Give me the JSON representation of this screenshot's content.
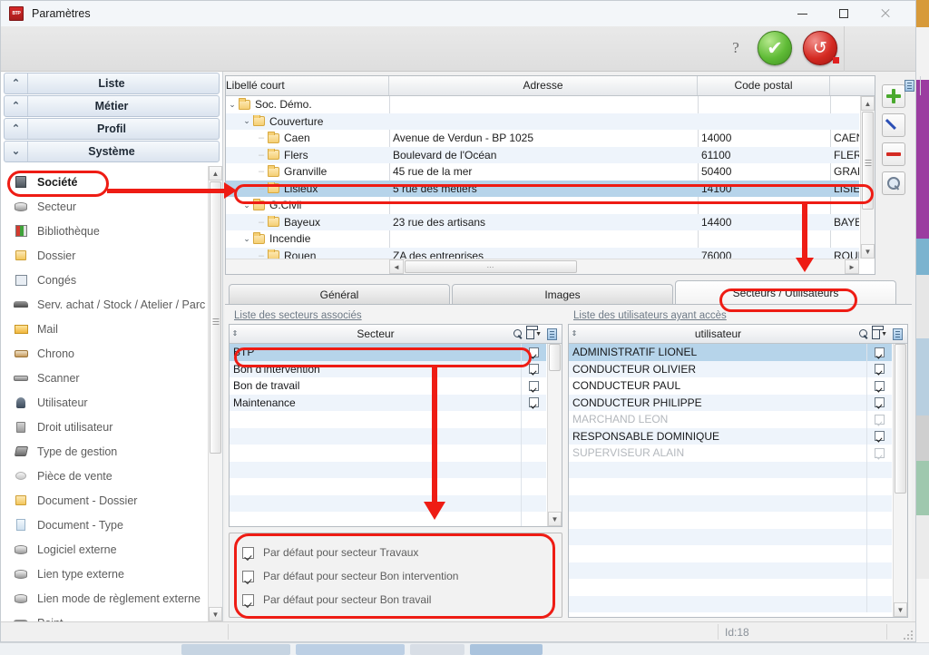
{
  "window": {
    "title": "Paramètres",
    "app_icon": "BTP",
    "minimize": "–",
    "maximize": "□",
    "close": "×"
  },
  "toolbar": {
    "help_label": "?",
    "validate_label": "✔",
    "cancel_label": "↺"
  },
  "sidebar": {
    "groups": [
      {
        "label": "Liste",
        "chevron": "⌃"
      },
      {
        "label": "Métier",
        "chevron": "⌃"
      },
      {
        "label": "Profil",
        "chevron": "⌃"
      },
      {
        "label": "Système",
        "chevron": "⌄"
      }
    ],
    "items": [
      {
        "label": "Société",
        "icon": "building-icon",
        "selected": true
      },
      {
        "label": "Secteur",
        "icon": "cylinder-icon",
        "selected": false
      },
      {
        "label": "Bibliothèque",
        "icon": "books-icon",
        "selected": false
      },
      {
        "label": "Dossier",
        "icon": "folder-icon",
        "selected": false
      },
      {
        "label": "Congés",
        "icon": "calendar-icon",
        "selected": false
      },
      {
        "label": "Serv. achat / Stock / Atelier / Parc",
        "icon": "truck-icon",
        "selected": false
      },
      {
        "label": "Mail",
        "icon": "envelope-icon",
        "selected": false
      },
      {
        "label": "Chrono",
        "icon": "book-icon",
        "selected": false
      },
      {
        "label": "Scanner",
        "icon": "scanner-icon",
        "selected": false
      },
      {
        "label": "Utilisateur",
        "icon": "user-icon",
        "selected": false
      },
      {
        "label": "Droit utilisateur",
        "icon": "lock-icon",
        "selected": false
      },
      {
        "label": "Type de gestion",
        "icon": "tag-icon",
        "selected": false
      },
      {
        "label": "Pièce de vente",
        "icon": "coin-icon",
        "selected": false
      },
      {
        "label": "Document - Dossier",
        "icon": "folder-doc-icon",
        "selected": false
      },
      {
        "label": "Document - Type",
        "icon": "page-icon",
        "selected": false
      },
      {
        "label": "Logiciel externe",
        "icon": "cylinder-icon",
        "selected": false
      },
      {
        "label": "Lien type externe",
        "icon": "cylinder-icon",
        "selected": false
      },
      {
        "label": "Lien mode de règlement externe",
        "icon": "cylinder-icon",
        "selected": false
      },
      {
        "label": "Point...",
        "icon": "truck-icon",
        "selected": false
      }
    ]
  },
  "tree": {
    "columns": [
      "Libellé court",
      "Adresse",
      "Code postal",
      ""
    ],
    "rows": [
      {
        "depth": 0,
        "twisty": "⌄",
        "label": "Soc. Démo.",
        "adresse": "",
        "cp": "",
        "ville": "",
        "selected": false
      },
      {
        "depth": 1,
        "twisty": "⌄",
        "label": "Couverture",
        "adresse": "",
        "cp": "",
        "ville": "",
        "selected": false
      },
      {
        "depth": 2,
        "twisty": "",
        "label": "Caen",
        "adresse": "Avenue de Verdun - BP 1025",
        "cp": "14000",
        "ville": "CAEN",
        "selected": false
      },
      {
        "depth": 2,
        "twisty": "",
        "label": "Flers",
        "adresse": "Boulevard de l'Océan",
        "cp": "61100",
        "ville": "FLERS",
        "selected": false
      },
      {
        "depth": 2,
        "twisty": "",
        "label": "Granville",
        "adresse": "45 rue de la mer",
        "cp": "50400",
        "ville": "GRANVILL",
        "selected": false
      },
      {
        "depth": 2,
        "twisty": "",
        "label": "Lisieux",
        "adresse": "5 rue des métiers",
        "cp": "14100",
        "ville": "LISIEUX",
        "selected": true
      },
      {
        "depth": 1,
        "twisty": "⌄",
        "label": "G.Civil",
        "adresse": "",
        "cp": "",
        "ville": "",
        "selected": false
      },
      {
        "depth": 2,
        "twisty": "",
        "label": "Bayeux",
        "adresse": "23 rue des artisans",
        "cp": "14400",
        "ville": "BAYEUX",
        "selected": false
      },
      {
        "depth": 1,
        "twisty": "⌄",
        "label": "Incendie",
        "adresse": "",
        "cp": "",
        "ville": "",
        "selected": false
      },
      {
        "depth": 2,
        "twisty": "",
        "label": "Rouen",
        "adresse": "ZA des entreprises",
        "cp": "76000",
        "ville": "ROUEN",
        "selected": false
      }
    ],
    "hscroll_left_arrow": "◄",
    "hscroll_right_arrow": "►",
    "hscroll_grip": "⋯"
  },
  "rail": {
    "add": "add-button",
    "edit": "edit-button",
    "delete": "delete-button",
    "search": "search-button"
  },
  "tabs": [
    {
      "label": "Général",
      "active": false
    },
    {
      "label": "Images",
      "active": false
    },
    {
      "label": "Secteurs / Utilisateurs",
      "active": true
    }
  ],
  "sectors_panel": {
    "title": "Liste des secteurs associés",
    "column": "Secteur",
    "rows": [
      {
        "name": "BTP",
        "checked": true,
        "selected": true,
        "dim": false
      },
      {
        "name": "Bon d'intervention",
        "checked": true,
        "selected": false,
        "dim": false
      },
      {
        "name": "Bon de travail",
        "checked": true,
        "selected": false,
        "dim": false
      },
      {
        "name": "Maintenance",
        "checked": true,
        "selected": false,
        "dim": false
      }
    ]
  },
  "users_panel": {
    "title": "Liste des utilisateurs ayant accès",
    "column": "utilisateur",
    "rows": [
      {
        "name": "ADMINISTRATIF LIONEL",
        "checked": true,
        "selected": true,
        "dim": false
      },
      {
        "name": "CONDUCTEUR OLIVIER",
        "checked": true,
        "selected": false,
        "dim": false
      },
      {
        "name": "CONDUCTEUR PAUL",
        "checked": true,
        "selected": false,
        "dim": false
      },
      {
        "name": "CONDUCTEUR PHILIPPE",
        "checked": true,
        "selected": false,
        "dim": false
      },
      {
        "name": "MARCHAND LEON",
        "checked": true,
        "selected": false,
        "dim": true
      },
      {
        "name": "RESPONSABLE DOMINIQUE",
        "checked": true,
        "selected": false,
        "dim": false
      },
      {
        "name": "SUPERVISEUR ALAIN",
        "checked": true,
        "selected": false,
        "dim": true
      }
    ]
  },
  "defaults": [
    {
      "label": "Par défaut pour secteur Travaux",
      "checked": true
    },
    {
      "label": "Par défaut pour secteur Bon intervention",
      "checked": true
    },
    {
      "label": "Par défaut pour secteur Bon travail",
      "checked": true
    }
  ],
  "statusbar": {
    "id_text": "Id:18"
  },
  "colors": {
    "annotation": "#ee1c14",
    "selection": "#b6d4ea",
    "accent_green": "#5fbb36",
    "accent_red": "#d42a22"
  }
}
